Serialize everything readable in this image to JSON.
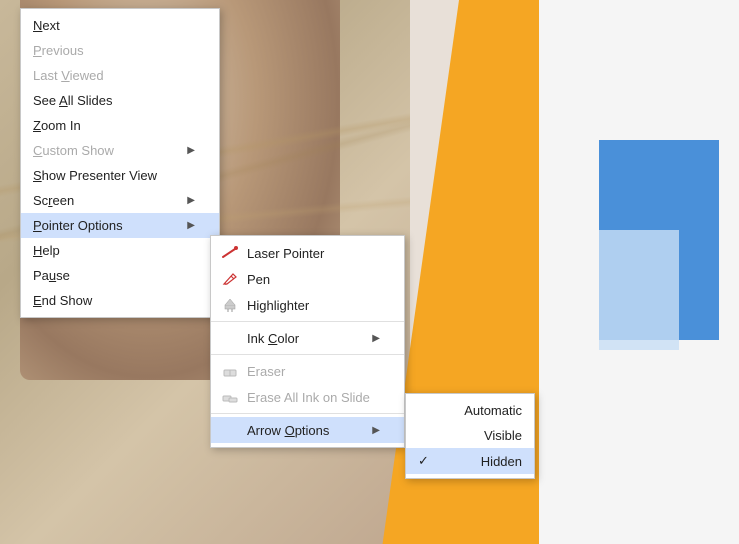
{
  "slide": {
    "description": "PowerPoint slide with photo background"
  },
  "mainMenu": {
    "items": [
      {
        "id": "next",
        "label": "Next",
        "underline": "N",
        "disabled": false,
        "hasSubmenu": false
      },
      {
        "id": "previous",
        "label": "Previous",
        "underline": "P",
        "disabled": true,
        "hasSubmenu": false
      },
      {
        "id": "last-viewed",
        "label": "Last Viewed",
        "underline": "L",
        "disabled": true,
        "hasSubmenu": false
      },
      {
        "id": "see-all-slides",
        "label": "See All Slides",
        "underline": "A",
        "disabled": false,
        "hasSubmenu": false
      },
      {
        "id": "zoom-in",
        "label": "Zoom In",
        "underline": "Z",
        "disabled": false,
        "hasSubmenu": false
      },
      {
        "id": "custom-show",
        "label": "Custom Show",
        "underline": "C",
        "disabled": true,
        "hasSubmenu": true
      },
      {
        "id": "show-presenter-view",
        "label": "Show Presenter View",
        "underline": "S",
        "disabled": false,
        "hasSubmenu": false
      },
      {
        "id": "screen",
        "label": "Screen",
        "underline": "r",
        "disabled": false,
        "hasSubmenu": true
      },
      {
        "id": "pointer-options",
        "label": "Pointer Options",
        "underline": "P",
        "disabled": false,
        "hasSubmenu": true,
        "active": true
      },
      {
        "id": "help",
        "label": "Help",
        "underline": "H",
        "disabled": false,
        "hasSubmenu": false
      },
      {
        "id": "pause",
        "label": "Pause",
        "underline": "u",
        "disabled": false,
        "hasSubmenu": false
      },
      {
        "id": "end-show",
        "label": "End Show",
        "underline": "E",
        "disabled": false,
        "hasSubmenu": false
      }
    ]
  },
  "pointerSubmenu": {
    "items": [
      {
        "id": "laser-pointer",
        "label": "Laser Pointer",
        "icon": "laser",
        "disabled": false
      },
      {
        "id": "pen",
        "label": "Pen",
        "icon": "pen",
        "disabled": false
      },
      {
        "id": "highlighter",
        "label": "Highlighter",
        "icon": "highlighter",
        "disabled": false
      },
      {
        "id": "ink-color",
        "label": "Ink Color",
        "icon": null,
        "disabled": false,
        "hasSubmenu": true
      },
      {
        "id": "eraser",
        "label": "Eraser",
        "icon": "eraser",
        "disabled": true
      },
      {
        "id": "erase-all-ink",
        "label": "Erase All Ink on Slide",
        "icon": "erase-all",
        "disabled": true
      },
      {
        "id": "arrow-options",
        "label": "Arrow Options",
        "icon": null,
        "disabled": false,
        "hasSubmenu": true,
        "active": true
      }
    ]
  },
  "arrowSubmenu": {
    "items": [
      {
        "id": "automatic",
        "label": "Automatic",
        "checked": false
      },
      {
        "id": "visible",
        "label": "Visible",
        "checked": false
      },
      {
        "id": "hidden",
        "label": "Hidden",
        "checked": true,
        "active": true
      }
    ]
  }
}
